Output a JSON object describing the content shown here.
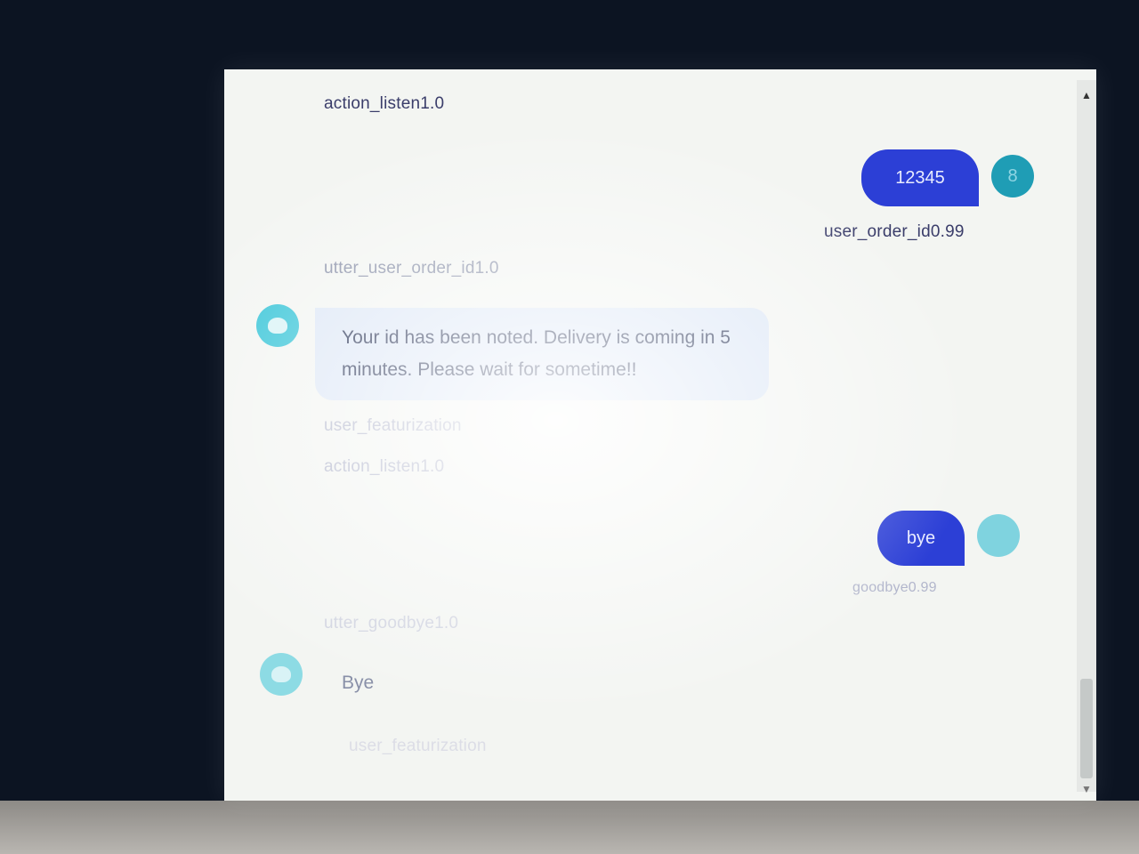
{
  "conversation": {
    "tag_action_listen_1": "action_listen1.0",
    "user_message_1": "12345",
    "user_avatar_1": "8",
    "tag_user_order_id": "user_order_id0.99",
    "tag_utter_user_order_id": "utter_user_order_id1.0",
    "bot_message_1": "Your id has been noted. Delivery is coming in 5 minutes. Please wait for sometime!!",
    "tag_user_featurization": "user_featurization",
    "tag_action_listen_2": "action_listen1.0",
    "user_message_2": "bye",
    "tag_goodbye": "goodbye0.99",
    "tag_utter_goodbye": "utter_goodbye1.0",
    "bot_message_2": "Bye",
    "tag_user_featurization_2": "user_featurization"
  },
  "icons": {
    "bot_avatar": "bot-face-icon",
    "user_avatar": "user-avatar-icon",
    "scroll_up": "triangle-up-icon",
    "scroll_down": "triangle-down-icon"
  },
  "colors": {
    "user_bubble": "#2c3fd6",
    "bot_bubble": "#dde7f6",
    "avatar": "#35c4d7",
    "screen_background": "#f3f5f2"
  }
}
